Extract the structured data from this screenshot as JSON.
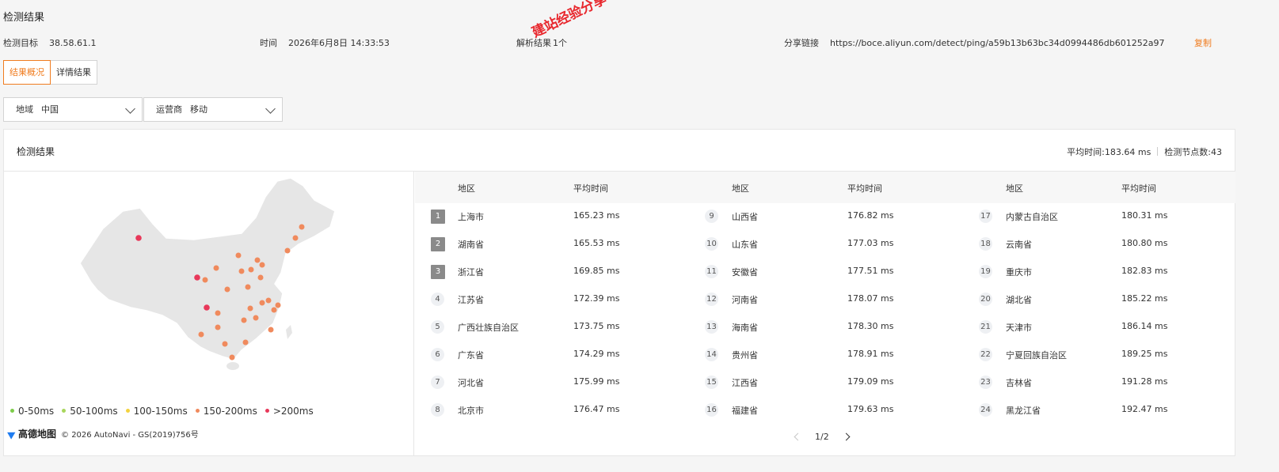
{
  "page_title": "检测结果",
  "info": {
    "target_label": "检测目标",
    "target_value": "38.58.61.1",
    "time_label": "时间",
    "time_value": "2026年6月8日 14:33:53",
    "parse_label": "解析结果",
    "parse_value": "1个",
    "share_label": "分享链接",
    "share_value": "https://boce.aliyun.com/detect/ping/a59b13b63bc34d0994486db601252a97",
    "copy_label": "复制"
  },
  "watermark": "建站经验分享-www.w...",
  "tabs": [
    {
      "label": "结果概况",
      "active": true
    },
    {
      "label": "详情结果",
      "active": false
    }
  ],
  "filters": {
    "region_label": "地域",
    "region_value": "中国",
    "isp_label": "运营商",
    "isp_value": "移动"
  },
  "panel": {
    "title": "检测结果",
    "avg_time": "平均时间:183.64 ms",
    "node_count": "检测节点数:43"
  },
  "legend": [
    {
      "label": "0-50ms",
      "color": "#7dcc4a"
    },
    {
      "label": "50-100ms",
      "color": "#a8d65c"
    },
    {
      "label": "100-150ms",
      "color": "#f3d23f"
    },
    {
      "label": "150-200ms",
      "color": "#f08a5d"
    },
    {
      "label": ">200ms",
      "color": "#e8385a"
    }
  ],
  "map_attribution": {
    "logo_text": "高德地图",
    "text": "© 2026 AutoNavi - GS(2019)756号"
  },
  "table": {
    "header_region": "地区",
    "header_time": "平均时间",
    "rows": [
      {
        "rank": "1",
        "region": "上海市",
        "time": "165.23 ms"
      },
      {
        "rank": "2",
        "region": "湖南省",
        "time": "165.53 ms"
      },
      {
        "rank": "3",
        "region": "浙江省",
        "time": "169.85 ms"
      },
      {
        "rank": "4",
        "region": "江苏省",
        "time": "172.39 ms"
      },
      {
        "rank": "5",
        "region": "广西壮族自治区",
        "time": "173.75 ms"
      },
      {
        "rank": "6",
        "region": "广东省",
        "time": "174.29 ms"
      },
      {
        "rank": "7",
        "region": "河北省",
        "time": "175.99 ms"
      },
      {
        "rank": "8",
        "region": "北京市",
        "time": "176.47 ms"
      },
      {
        "rank": "9",
        "region": "山西省",
        "time": "176.82 ms"
      },
      {
        "rank": "10",
        "region": "山东省",
        "time": "177.03 ms"
      },
      {
        "rank": "11",
        "region": "安徽省",
        "time": "177.51 ms"
      },
      {
        "rank": "12",
        "region": "河南省",
        "time": "178.07 ms"
      },
      {
        "rank": "13",
        "region": "海南省",
        "time": "178.30 ms"
      },
      {
        "rank": "14",
        "region": "贵州省",
        "time": "178.91 ms"
      },
      {
        "rank": "15",
        "region": "江西省",
        "time": "179.09 ms"
      },
      {
        "rank": "16",
        "region": "福建省",
        "time": "179.63 ms"
      },
      {
        "rank": "17",
        "region": "内蒙古自治区",
        "time": "180.31 ms"
      },
      {
        "rank": "18",
        "region": "云南省",
        "time": "180.80 ms"
      },
      {
        "rank": "19",
        "region": "重庆市",
        "time": "182.83 ms"
      },
      {
        "rank": "20",
        "region": "湖北省",
        "time": "185.22 ms"
      },
      {
        "rank": "21",
        "region": "天津市",
        "time": "186.14 ms"
      },
      {
        "rank": "22",
        "region": "宁夏回族自治区",
        "time": "189.25 ms"
      },
      {
        "rank": "23",
        "region": "吉林省",
        "time": "191.28 ms"
      },
      {
        "rank": "24",
        "region": "黑龙江省",
        "time": "192.47 ms"
      }
    ]
  },
  "pager": {
    "text": "1/2"
  }
}
